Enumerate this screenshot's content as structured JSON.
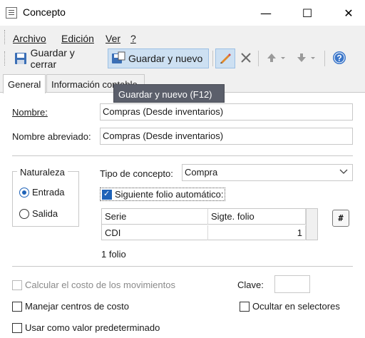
{
  "window": {
    "title": "Concepto",
    "minimize_glyph": "—",
    "maximize_glyph": "☐",
    "close_glyph": "✕"
  },
  "menu": [
    {
      "label": "Archivo",
      "underline_index": 0
    },
    {
      "label": "Edición",
      "underline_index": 0
    },
    {
      "label": "Ver",
      "underline_index": 0
    },
    {
      "label": "?",
      "underline_index": 0
    }
  ],
  "toolbar": {
    "save_close_label": "Guardar y cerrar",
    "save_new_label": "Guardar y nuevo",
    "icons": [
      "save-icon",
      "save-new-icon",
      "edit-pencil-icon",
      "delete-x-icon",
      "arrow-up-icon",
      "arrow-down-icon",
      "help-icon"
    ],
    "colors": {
      "accent": "#1f63b8",
      "hover_bg": "#cde0f2",
      "delete": "#6a6a6a"
    }
  },
  "tooltip": "Guardar y nuevo (F12)",
  "tabs": [
    {
      "label": "General",
      "active": true
    },
    {
      "label": "Información contable",
      "active": false
    }
  ],
  "form": {
    "nombre_label": "Nombre:",
    "nombre_value": "Compras (Desde inventarios)",
    "nombre_abrev_label": "Nombre abreviado:",
    "nombre_abrev_value": "Compras (Desde inventarios)",
    "naturaleza": {
      "legend": "Naturaleza",
      "entrada": "Entrada",
      "salida": "Salida",
      "selected": "Entrada"
    },
    "tipo_concepto_label": "Tipo de concepto:",
    "tipo_concepto_value": "Compra",
    "siguiente_folio_label": "Siguiente folio automático:",
    "siguiente_folio_checked": true,
    "grid": {
      "columns": [
        "Serie",
        "Sigte. folio"
      ],
      "rows": [
        {
          "serie": "CDI",
          "folio": "1"
        }
      ],
      "button_label": "#",
      "count_label": "1 folio"
    },
    "calcular_costo_label": "Calcular el costo de los movimientos",
    "clave_label": "Clave:",
    "clave_value": "",
    "centros_costo_label": "Manejar centros de costo",
    "ocultar_selectores_label": "Ocultar en selectores",
    "valor_predeterminado_label": "Usar como valor predeterminado"
  }
}
